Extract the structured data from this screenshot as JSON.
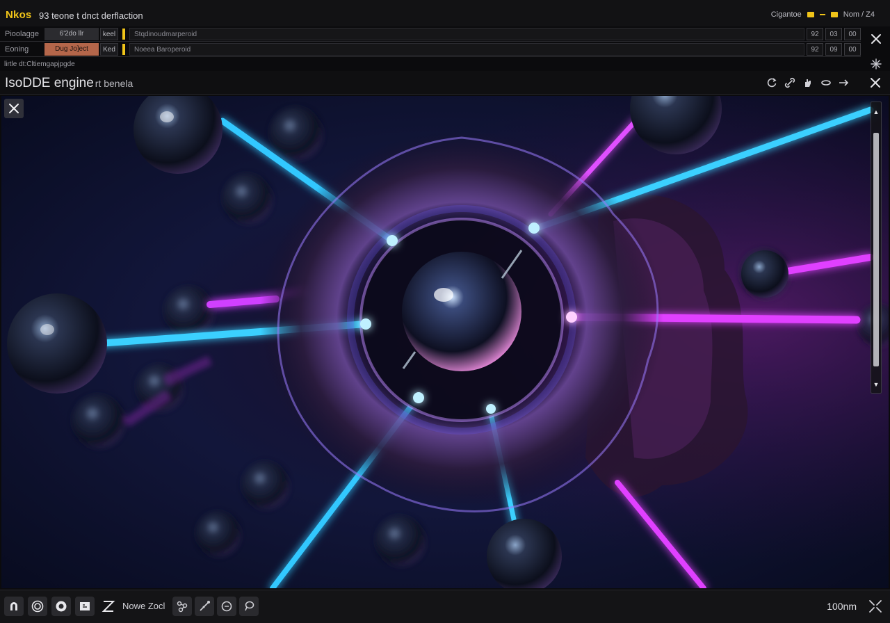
{
  "app": {
    "brand": "Nkos",
    "title": "93 teone t dnct derflaction",
    "top_right_label": "Cigantoe",
    "top_right_item": "Nom / Z4"
  },
  "properties": {
    "rows": [
      {
        "label": "Pioolagge",
        "value": "6'2do llr",
        "key": "keel",
        "path": "Stqdinoudmarperoid",
        "nums": [
          "92",
          "03",
          "00"
        ]
      },
      {
        "label": "Eoning",
        "value": "Dug Jo]ect",
        "key": "Ked",
        "path": "Noeea Baroperoid",
        "nums": [
          "92",
          "09",
          "00"
        ]
      }
    ]
  },
  "subtitle": "lirtle dt:Cltiemgapjpgde",
  "panel": {
    "title": "IsoDDE engine",
    "title_suffix": "rt benela"
  },
  "bottombar": {
    "label": "Nowe Zocl",
    "zoom": "100nm"
  },
  "colors": {
    "accent": "#f0c419",
    "active_value": "#b4664a",
    "beam_cyan": "#33c8ff",
    "beam_magenta": "#e040ff"
  },
  "icons": {
    "props_close": "close-icon",
    "viewport_close": "close-icon",
    "panel_close": "close-icon",
    "tools": [
      "refresh-icon",
      "link-icon",
      "hand-icon",
      "wrench-icon",
      "arrow-icon"
    ],
    "bottom": [
      "arc-icon",
      "orbit-icon",
      "rotate-icon",
      "grid-icon",
      "zigzag-icon",
      "molecule-icon",
      "beam-icon",
      "circle-icon",
      "lasso-icon",
      "fit-icon"
    ]
  }
}
